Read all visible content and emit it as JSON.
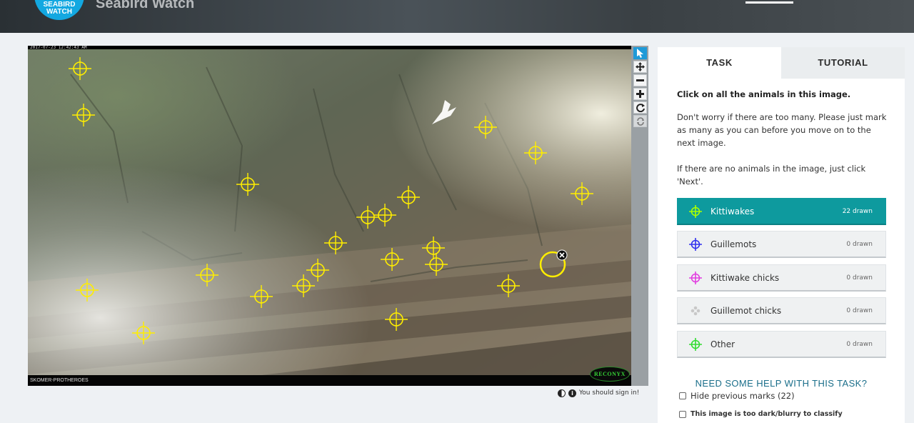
{
  "header": {
    "logo_line1": "SEABIRD",
    "logo_line2": "WATCH",
    "title": "Seabird Watch"
  },
  "viewer": {
    "camera_timestamp": "2017-07-23 12:42:43 AM",
    "camera_location": "SKOMER-PROTHEROES",
    "camera_brand": "RECONYX",
    "mark_color": "#ffee00"
  },
  "toolbar": {
    "tools": [
      "pointer-icon",
      "move-icon",
      "zoom-out-icon",
      "zoom-in-icon",
      "rotate-icon",
      "reset-icon"
    ]
  },
  "status": {
    "sign_in_text": "You should sign in!"
  },
  "task": {
    "tabs": [
      {
        "label": "TASK",
        "active": true
      },
      {
        "label": "TUTORIAL",
        "active": false
      }
    ],
    "question": "Click on all the animals in this image.",
    "paragraph1": "Don't worry if there are too many. Please just mark as many as you can before you move on to the next image.",
    "paragraph2": "If there are no animals in the image, just click 'Next'.",
    "answers": [
      {
        "label": "Kittiwakes",
        "count": "22 drawn",
        "color": "#aaff00",
        "selected": true
      },
      {
        "label": "Guillemots",
        "count": "0 drawn",
        "color": "#3333ee",
        "selected": false
      },
      {
        "label": "Kittiwake chicks",
        "count": "0 drawn",
        "color": "#e23ee0",
        "selected": false
      },
      {
        "label": "Guillemot chicks",
        "count": "0 drawn",
        "color": "#c8c8c8",
        "selected": false
      },
      {
        "label": "Other",
        "count": "0 drawn",
        "color": "#33dd33",
        "selected": false
      }
    ],
    "help_label": "NEED SOME HELP WITH THIS TASK?",
    "hide_marks_label": "Hide previous marks (22)",
    "too_dark_label": "This image is too dark/blurry to classify"
  }
}
